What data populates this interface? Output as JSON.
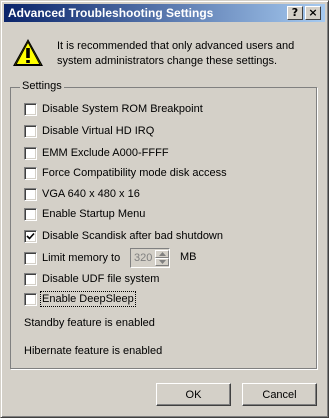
{
  "window": {
    "title": "Advanced Troubleshooting Settings",
    "help_label": "?",
    "close_label": "×"
  },
  "warning": {
    "icon": "warning-icon",
    "text": "It is recommended that only advanced users and system administrators change these settings."
  },
  "settings": {
    "legend": "Settings",
    "options": [
      {
        "label": "Disable System ROM Breakpoint",
        "checked": false,
        "enabled": true
      },
      {
        "label": "Disable Virtual HD IRQ",
        "checked": false,
        "enabled": true
      },
      {
        "label": "EMM Exclude A000-FFFF",
        "checked": false,
        "enabled": true
      },
      {
        "label": "Force Compatibility mode disk access",
        "checked": false,
        "enabled": true
      },
      {
        "label": "VGA 640 x 480 x 16",
        "checked": false,
        "enabled": true
      },
      {
        "label": "Enable Startup Menu",
        "checked": false,
        "enabled": true
      },
      {
        "label": "Disable Scandisk after bad shutdown",
        "checked": true,
        "enabled": true
      },
      {
        "label": "Limit memory to",
        "checked": false,
        "enabled": true
      },
      {
        "label": "Disable UDF file system",
        "checked": false,
        "enabled": true
      },
      {
        "label": "Enable DeepSleep",
        "checked": false,
        "enabled": true,
        "focused": true
      }
    ],
    "memory_limit": {
      "value": "320",
      "unit": "MB",
      "enabled": false
    },
    "standby_status": "Standby feature is enabled",
    "hibernate_status": "Hibernate feature is enabled"
  },
  "buttons": {
    "ok": "OK",
    "cancel": "Cancel"
  }
}
